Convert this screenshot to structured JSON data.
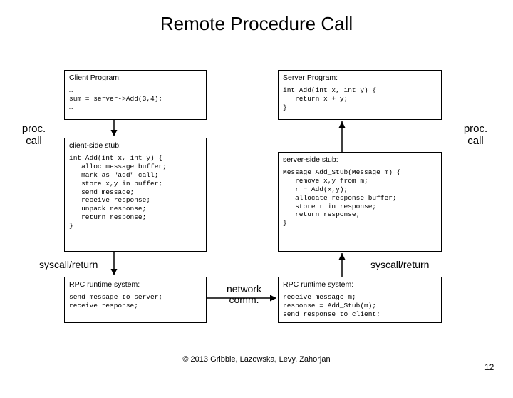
{
  "title": "Remote Procedure Call",
  "client": {
    "title": "Client Program:",
    "code": "…\nsum = server->Add(3,4);\n…"
  },
  "server": {
    "title": "Server Program:",
    "code": "int Add(int x, int y) {\n   return x + y;\n}"
  },
  "clientStub": {
    "title": "client-side stub:",
    "code": "int Add(int x, int y) {\n   alloc message buffer;\n   mark as \"add\" call;\n   store x,y in buffer;\n   send message;\n   receive response;\n   unpack response;\n   return response;\n}"
  },
  "serverStub": {
    "title": "server-side stub:",
    "code": "Message Add_Stub(Message m) {\n   remove x,y from m;\n   r = Add(x,y);\n   allocate response buffer;\n   store r in response;\n   return response;\n}"
  },
  "clientRuntime": {
    "title": "RPC runtime system:",
    "code": "send message to server;\nreceive response;"
  },
  "serverRuntime": {
    "title": "RPC runtime system:",
    "code": "receive message m;\nresponse = Add_Stub(m);\nsend response to client;"
  },
  "labels": {
    "procCallL": "proc.\ncall",
    "procCallR": "proc.\ncall",
    "syscallL": "syscall/return",
    "syscallR": "syscall/return",
    "network": "network\ncomm."
  },
  "copyright": "© 2013 Gribble, Lazowska, Levy, Zahorjan",
  "page": "12"
}
